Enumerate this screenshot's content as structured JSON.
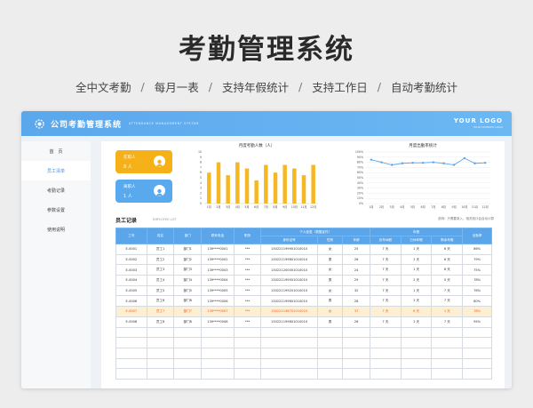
{
  "hero": {
    "title": "考勤管理系统",
    "features": [
      "全中文考勤",
      "每月一表",
      "支持年假统计",
      "支持工作日",
      "自动考勤统计"
    ],
    "separator": "/"
  },
  "window": {
    "title": "公司考勤管理系统",
    "title_en": "ATTENDANCE MANAGEMENT SYSTEM",
    "logo_text": "YOUR LOGO",
    "logo_sub": "YOUR COMPANY LOGO",
    "accent": "#5ba7ec"
  },
  "sidebar": {
    "items": [
      {
        "label": "首　页",
        "active": false
      },
      {
        "label": "员工清单",
        "active": true
      },
      {
        "label": "考勤记录",
        "active": false
      },
      {
        "label": "参数设置",
        "active": false
      },
      {
        "label": "使用说明",
        "active": false
      }
    ]
  },
  "cards": [
    {
      "title": "在职人",
      "value": "8 人",
      "color": "#f6b018",
      "icon": "user-icon"
    },
    {
      "title": "离职人",
      "value": "1 人",
      "color": "#58a9ee",
      "icon": "user-icon"
    }
  ],
  "chart_data": [
    {
      "type": "bar",
      "title": "月度考勤人数（人）",
      "categories": [
        "1月",
        "2月",
        "3月",
        "4月",
        "5月",
        "6月",
        "7月",
        "8月",
        "9月",
        "10月",
        "11月",
        "12月"
      ],
      "values": [
        6,
        8,
        5.5,
        8,
        6.8,
        4.5,
        7.5,
        6,
        7.5,
        6.8,
        5.5,
        7.5
      ],
      "ylim": [
        0,
        10
      ],
      "yticks": [
        "0",
        "1",
        "2",
        "3",
        "4",
        "5",
        "6",
        "7",
        "8",
        "9",
        "10"
      ],
      "color": "#f4b822",
      "grid": false
    },
    {
      "type": "line",
      "title": "月度出勤率统计",
      "categories": [
        "1月",
        "2月",
        "3月",
        "4月",
        "5月",
        "6月",
        "7月",
        "8月",
        "9月",
        "10月",
        "11月",
        "12月"
      ],
      "values": [
        85,
        80,
        75,
        78,
        79,
        79,
        80,
        78,
        75,
        88,
        78,
        79
      ],
      "ylim": [
        0,
        100
      ],
      "yticks": [
        "0%",
        "10%",
        "20%",
        "30%",
        "40%",
        "50%",
        "60%",
        "70%",
        "80%",
        "90%",
        "100%"
      ],
      "color": "#5ba5ea",
      "grid": true
    }
  ],
  "records": {
    "title": "员工记录",
    "title_en": "EMPLOYEE LIST",
    "note": "说明：只需要录入，相关统计会自动计算",
    "header": {
      "group_personal": "个人信息（根据证件）",
      "group_annual": "年假",
      "cols": [
        "工号",
        "姓名",
        "部门",
        "联系电话",
        "职务",
        "身份证号",
        "性别",
        "年龄",
        "总年休假",
        "已休年假",
        "剩余年假",
        "出勤率"
      ]
    },
    "rows": [
      [
        "E-0001",
        "员工1",
        "部门1",
        "139****0001",
        "***",
        "130221199901010010",
        "女",
        "25",
        "7 天",
        "1 天",
        "6 天",
        "86%"
      ],
      [
        "E-0002",
        "员工2",
        "部门2",
        "139****0002",
        "***",
        "130221199801010010",
        "男",
        "26",
        "7 天",
        "1 天",
        "6 天",
        "79%"
      ],
      [
        "E-0003",
        "员工3",
        "部门3",
        "139****0003",
        "***",
        "130221200001010010",
        "女",
        "24",
        "7 天",
        "1 天",
        "6 天",
        "75%"
      ],
      [
        "E-0004",
        "员工4",
        "部门4",
        "139****0004",
        "***",
        "130221199501010010",
        "男",
        "29",
        "7 天",
        "2 天",
        "5 天",
        "78%"
      ],
      [
        "E-0005",
        "员工5",
        "部门5",
        "139****0005",
        "***",
        "130221199201010010",
        "女",
        "32",
        "7 天",
        "1 天",
        "7 天",
        "76%"
      ],
      [
        "E-0006",
        "员工6",
        "部门6",
        "139****0006",
        "***",
        "130221199601010010",
        "男",
        "28",
        "7 天",
        "1 天",
        "7 天",
        "80%"
      ],
      [
        "E-0007",
        "员工7",
        "部门7",
        "139****0007",
        "***",
        "130221198701010010",
        "女",
        "37",
        "7 天",
        "6 天",
        "1 天",
        "78%"
      ],
      [
        "E-0008",
        "员工8",
        "部门8",
        "139****0008",
        "***",
        "130221199801010010",
        "男",
        "26",
        "7 天",
        "1 天",
        "7 天",
        "95%"
      ]
    ],
    "highlight_row": 6,
    "empty_rows": 5
  }
}
